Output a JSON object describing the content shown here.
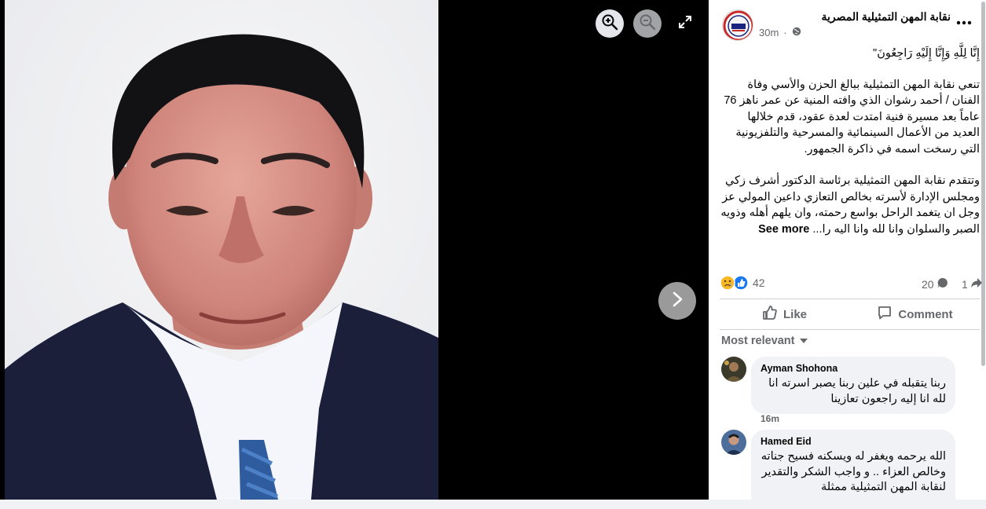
{
  "viewer": {
    "zoom_in_icon": "zoom-in-icon",
    "zoom_out_icon": "zoom-out-icon",
    "expand_icon": "expand-icon",
    "next_icon": "chevron-right-icon"
  },
  "post": {
    "page_name": "نقابة المهن التمثيلية المصرية",
    "time": "30m",
    "privacy_icon": "globe-icon",
    "paragraphs": {
      "p1": "إِنَّا لِلَّهِ وَإِنَّا إِلَيْهِ رَاجِعُونَ\"",
      "p2": "تنعي نقابة المهن التمثيلية ببالغ الحزن والأسي وفاة الفنان / أحمد رشوان الذي وافته المنية عن عمر ناهز 76 عاماً بعد مسيرة فنية امتدت لعدة عقود، قدم خلالها العديد من الأعمال السينمائية والمسرحية والتلفزيونية التي رسخت اسمه في ذاكرة الجمهور.",
      "p3": "وتتقدم نقابة المهن التمثيلية برئاسة الدكتور أشرف زكي ومجلس الإدارة لأسرته بخالص التعازي داعين المولي عز وجل ان يتغمد الراحل بواسع رحمته، وان يلهم أهله وذويه الصبر والسلوان وانا لله وانا اليه را..."
    },
    "see_more": "See more",
    "reaction_count": "42",
    "comment_count": "20",
    "share_count": "1"
  },
  "actions": {
    "like": "Like",
    "comment": "Comment"
  },
  "sort": {
    "label": "Most relevant"
  },
  "comments": [
    {
      "author": "Ayman Shohona",
      "text": "ربنا يتقبله في علين ربنا يصبر اسرته انا لله انا إليه راجعون تعازينا",
      "time": "16m"
    },
    {
      "author": "Hamed Eid",
      "text": "الله يرحمه ويغفر له ويسكنه فسيح جناته وخالص العزاء .. و واجب الشكر والتقدير لنقابة المهن التمثيلية ممثلة",
      "time": ""
    }
  ],
  "colors": {
    "like_blue": "#1877f2",
    "muted_text": "#65676b",
    "bubble_bg": "#f0f2f5"
  }
}
